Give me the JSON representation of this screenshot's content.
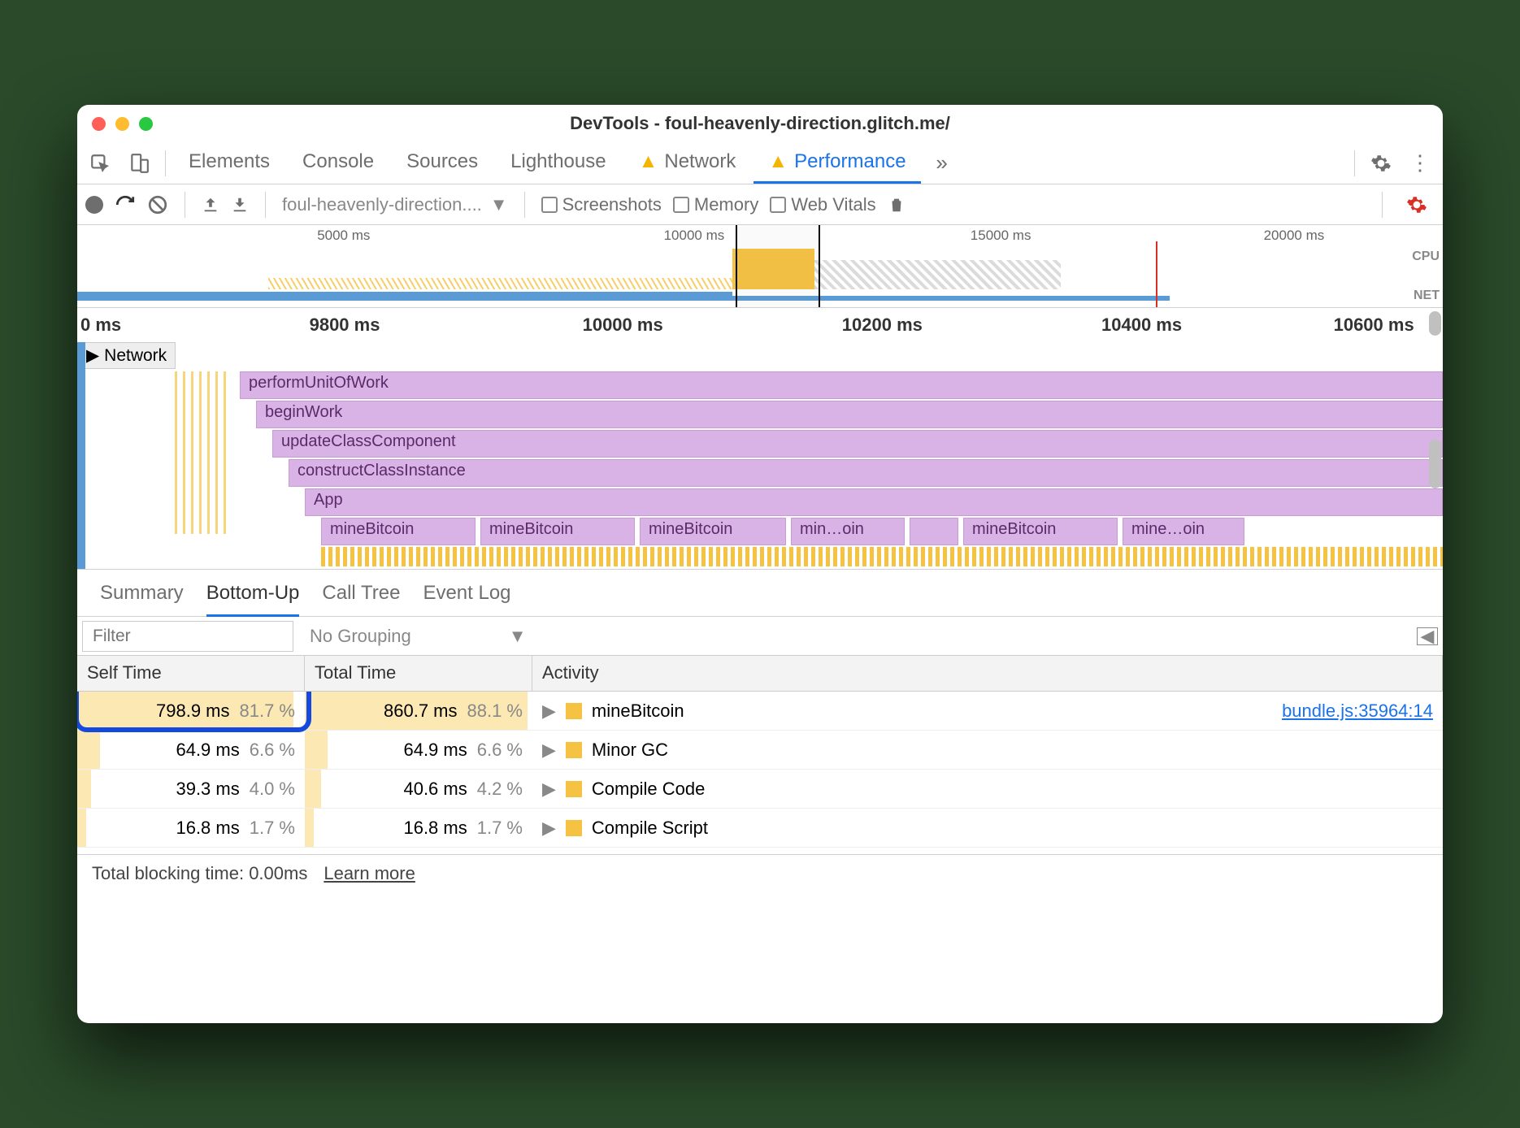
{
  "window": {
    "title": "DevTools - foul-heavenly-direction.glitch.me/"
  },
  "tabs": [
    "Elements",
    "Console",
    "Sources",
    "Lighthouse",
    "Network",
    "Performance"
  ],
  "active_tab": "Performance",
  "toolbar": {
    "profile_name": "foul-heavenly-direction....",
    "chk_screenshots": "Screenshots",
    "chk_memory": "Memory",
    "chk_webvitals": "Web Vitals"
  },
  "overview": {
    "ticks": [
      "5000 ms",
      "10000 ms",
      "15000 ms",
      "20000 ms"
    ],
    "labels": {
      "cpu": "CPU",
      "net": "NET"
    }
  },
  "timeline": {
    "ticks": [
      "0 ms",
      "9800 ms",
      "10000 ms",
      "10200 ms",
      "10400 ms",
      "10600 ms"
    ]
  },
  "flame": {
    "network_label": "Network",
    "rows": [
      "performUnitOfWork",
      "beginWork",
      "updateClassComponent",
      "constructClassInstance",
      "App"
    ],
    "bitcoin": [
      "mineBitcoin",
      "mineBitcoin",
      "mineBitcoin",
      "min…oin",
      "mineBitcoin",
      "mine…oin"
    ]
  },
  "bottom_tabs": [
    "Summary",
    "Bottom-Up",
    "Call Tree",
    "Event Log"
  ],
  "bottom_active": "Bottom-Up",
  "filter": {
    "placeholder": "Filter",
    "grouping": "No Grouping"
  },
  "table": {
    "headers": {
      "self": "Self Time",
      "total": "Total Time",
      "activity": "Activity"
    },
    "rows": [
      {
        "self_ms": "798.9 ms",
        "self_pct": "81.7 %",
        "self_bar": 95,
        "tot_ms": "860.7 ms",
        "tot_pct": "88.1 %",
        "tot_bar": 98,
        "name": "mineBitcoin",
        "link": "bundle.js:35964:14"
      },
      {
        "self_ms": "64.9 ms",
        "self_pct": "6.6 %",
        "self_bar": 10,
        "tot_ms": "64.9 ms",
        "tot_pct": "6.6 %",
        "tot_bar": 10,
        "name": "Minor GC",
        "link": ""
      },
      {
        "self_ms": "39.3 ms",
        "self_pct": "4.0 %",
        "self_bar": 6,
        "tot_ms": "40.6 ms",
        "tot_pct": "4.2 %",
        "tot_bar": 7,
        "name": "Compile Code",
        "link": ""
      },
      {
        "self_ms": "16.8 ms",
        "self_pct": "1.7 %",
        "self_bar": 4,
        "tot_ms": "16.8 ms",
        "tot_pct": "1.7 %",
        "tot_bar": 4,
        "name": "Compile Script",
        "link": ""
      }
    ]
  },
  "footer": {
    "tbt": "Total blocking time: 0.00ms",
    "learn": "Learn more"
  }
}
